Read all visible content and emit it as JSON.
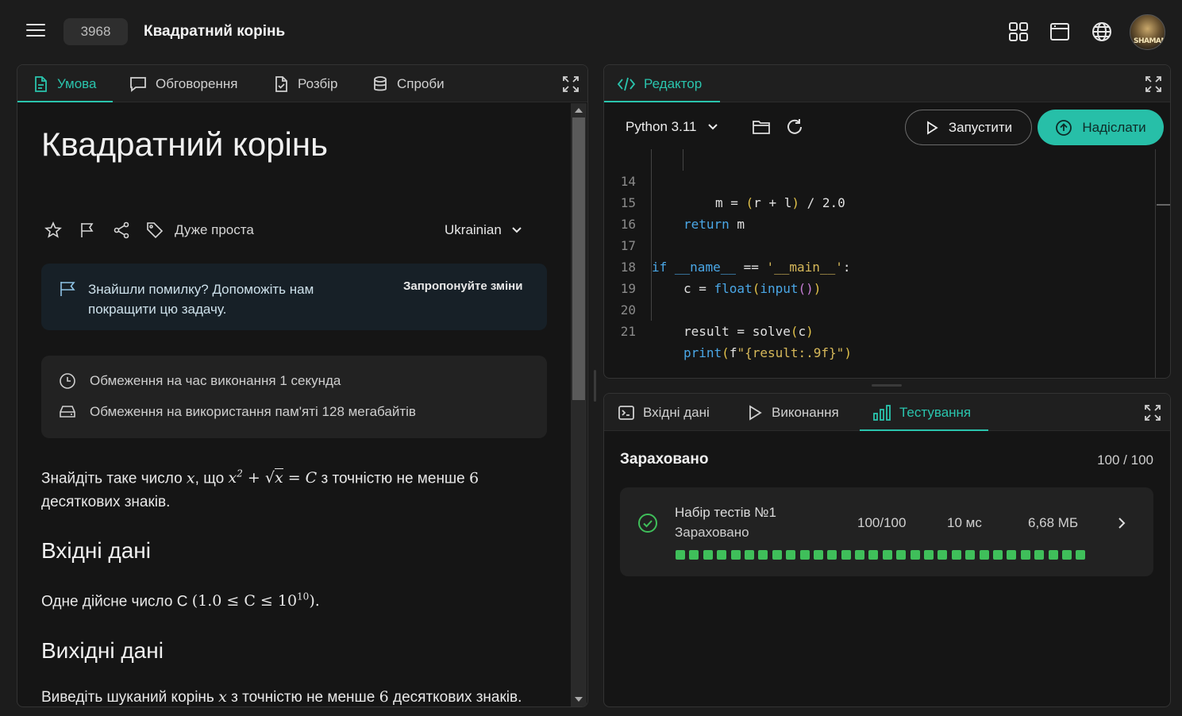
{
  "topbar": {
    "problem_number": "3968",
    "problem_title": "Квадратний корінь",
    "icons": [
      "grid-icon",
      "window-icon",
      "globe-icon"
    ],
    "avatar_text": "SHAMAN"
  },
  "left_panel": {
    "tabs": [
      {
        "label": "Умова",
        "icon": "document-icon",
        "active": true
      },
      {
        "label": "Обговорення",
        "icon": "chat-icon",
        "active": false
      },
      {
        "label": "Розбір",
        "icon": "checklist-icon",
        "active": false
      },
      {
        "label": "Спроби",
        "icon": "database-icon",
        "active": false
      }
    ],
    "title": "Квадратний корінь",
    "difficulty": "Дуже проста",
    "language": "Ukrainian",
    "help": {
      "text": "Знайшли помилку? Допоможіть нам покращити цю задачу.",
      "link": "Запропонуйте зміни"
    },
    "limits": {
      "time": "Обмеження на час виконання 1 секунда",
      "memory": "Обмеження на використання пам'яті 128 мегабайтів"
    },
    "statement": {
      "p1_a": "Знайдіть таке число ",
      "p1_x": "x",
      "p1_b": ", що ",
      "p1_c": " з точністю не менше ",
      "p1_six": "6",
      "p1_d": " десяткових знаків.",
      "input_heading": "Вхідні дані",
      "input_a": "Одне дійсне число C ",
      "input_range": "(1.0 ≤ C ≤ 10",
      "input_exp": "10",
      "input_close": ").",
      "output_heading": "Вихідні дані",
      "output_a": "Виведіть шуканий корінь ",
      "output_x": "x",
      "output_b": " з точністю не менше ",
      "output_six": "6",
      "output_c": " десяткових знаків."
    }
  },
  "editor": {
    "tab_label": "Редактор",
    "language": "Python 3.11",
    "run_label": "Запустити",
    "submit_label": "Надіслати",
    "code_lines": [
      {
        "n": "14",
        "text": "m = (r + l) / 2.0"
      },
      {
        "n": "15",
        "text": "return m"
      },
      {
        "n": "16",
        "text": ""
      },
      {
        "n": "17",
        "text": "if __name__ == '__main__':"
      },
      {
        "n": "18",
        "text": "c = float(input())"
      },
      {
        "n": "19",
        "text": ""
      },
      {
        "n": "20",
        "text": "result = solve(c)"
      },
      {
        "n": "21",
        "text": "print(f\"{result:.9f}\")"
      }
    ]
  },
  "bottom_panel": {
    "tabs": [
      {
        "label": "Вхідні дані",
        "icon": "terminal-icon",
        "active": false
      },
      {
        "label": "Виконання",
        "icon": "play-icon",
        "active": false
      },
      {
        "label": "Тестування",
        "icon": "bar-chart-icon",
        "active": true
      }
    ],
    "verdict": "Зараховано",
    "score": "100 / 100",
    "test_set": {
      "name": "Набір тестів №1",
      "status": "Зараховано",
      "points": "100/100",
      "time": "10 мс",
      "memory": "6,68 МБ",
      "passed_tests": 30
    }
  },
  "colors": {
    "accent": "#2ac4ad",
    "pass": "#3fbf5a",
    "background": "#1c1c1c"
  }
}
